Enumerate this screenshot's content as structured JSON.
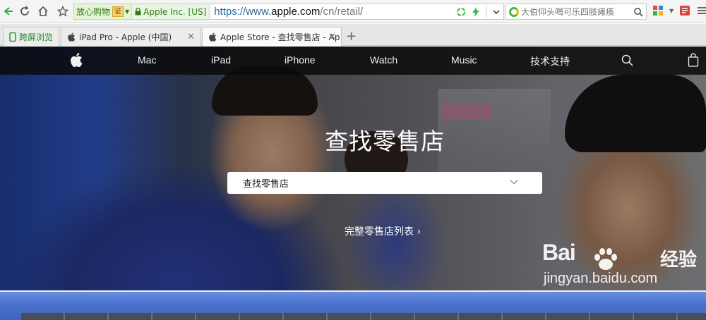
{
  "browser": {
    "safe_shopping_label": "放心购物",
    "cert_badge": "证",
    "ssl_org": "Apple Inc. [US]",
    "url_scheme": "https://www.",
    "url_host": "apple.com",
    "url_path": "/cn/retail/",
    "search_placeholder": "大伯仰头喝可乐四肢瘫痪"
  },
  "tabs": [
    {
      "label": "跨屏浏览"
    },
    {
      "label": "iPad Pro - Apple (中国)"
    },
    {
      "label": "Apple Store - 查找零售店 - Ap"
    }
  ],
  "nav": {
    "items": [
      "Mac",
      "iPad",
      "iPhone",
      "Watch",
      "Music",
      "技术支持"
    ]
  },
  "hero": {
    "title": "查找零售店",
    "select_value": "查找零售店",
    "link_text": "完整零售店列表 ›"
  },
  "watermark": {
    "logo": "Bai",
    "logo_cn": "经验",
    "url": "jingyan.baidu.com"
  },
  "colors": {
    "nav_bg": "#0a0a0a",
    "url_host": "#111111",
    "safe_green": "#2c7a10"
  }
}
